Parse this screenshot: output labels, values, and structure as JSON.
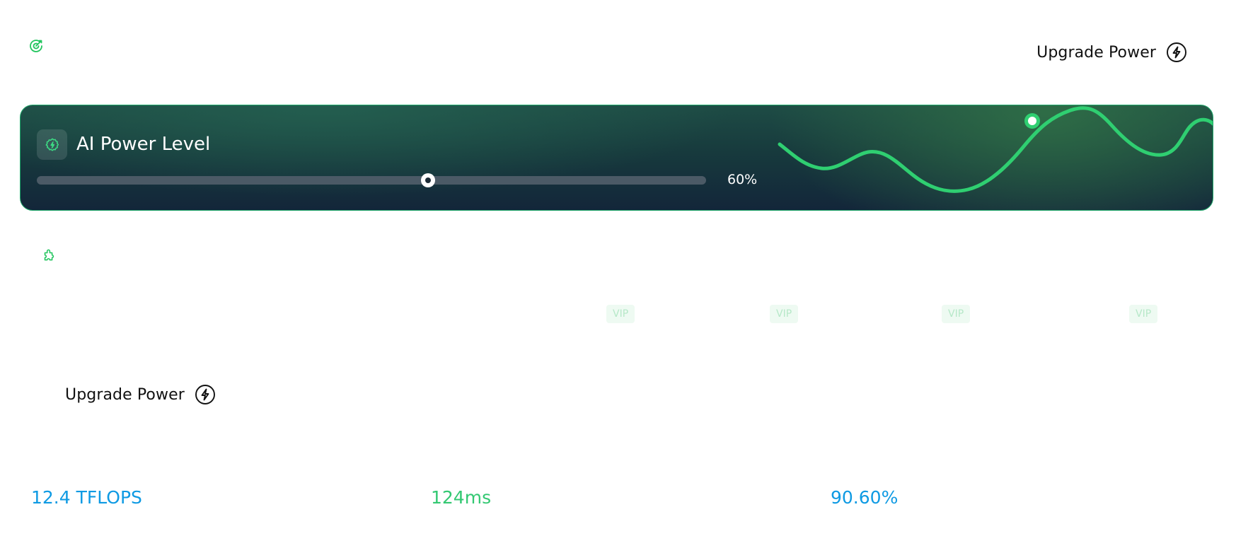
{
  "header": {
    "logo_icon": "refresh-target-icon",
    "upgrade_label": "Upgrade Power",
    "upgrade_icon": "lightning-circle-icon"
  },
  "power_card": {
    "icon": "lightning-gear-icon",
    "title": "AI Power Level",
    "slider_value": 0.6,
    "slider_value_label": "60%",
    "wave_color": "#2fcf71"
  },
  "section": {
    "icon": "puzzle-icon",
    "vip_badges": [
      "VIP",
      "VIP",
      "VIP",
      "VIP"
    ],
    "upgrade_label": "Upgrade Power",
    "upgrade_icon": "lightning-circle-icon"
  },
  "metrics": [
    {
      "value": "12.4 TFLOPS",
      "color": "#0e9ae3"
    },
    {
      "value": "124ms",
      "color": "#33c872"
    },
    {
      "value": "90.60%",
      "color": "#0e9ae3"
    }
  ],
  "colors": {
    "accent_green": "#22c55e",
    "accent_blue": "#0e9ae3",
    "card_dark": "#13263a"
  }
}
